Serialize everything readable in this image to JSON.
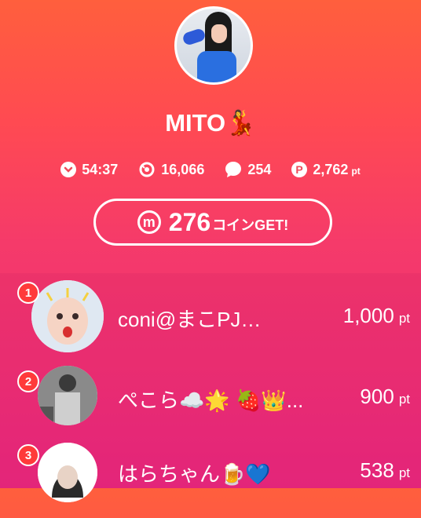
{
  "profile": {
    "name": "MITO💃"
  },
  "stats": {
    "time": "54:37",
    "views": "16,066",
    "comments": "254",
    "points": "2,762",
    "points_unit": "pt"
  },
  "coin": {
    "icon_letter": "m",
    "amount": "276",
    "suffix": "コインGET!"
  },
  "ranking": [
    {
      "rank": "1",
      "name": "coni@まこPJ…",
      "points": "1,000",
      "unit": "pt"
    },
    {
      "rank": "2",
      "name": "ぺこら☁️🌟 🍓👑...",
      "points": "900",
      "unit": "pt"
    },
    {
      "rank": "3",
      "name": "はらちゃん🍺💙",
      "points": "538",
      "unit": "pt"
    }
  ]
}
